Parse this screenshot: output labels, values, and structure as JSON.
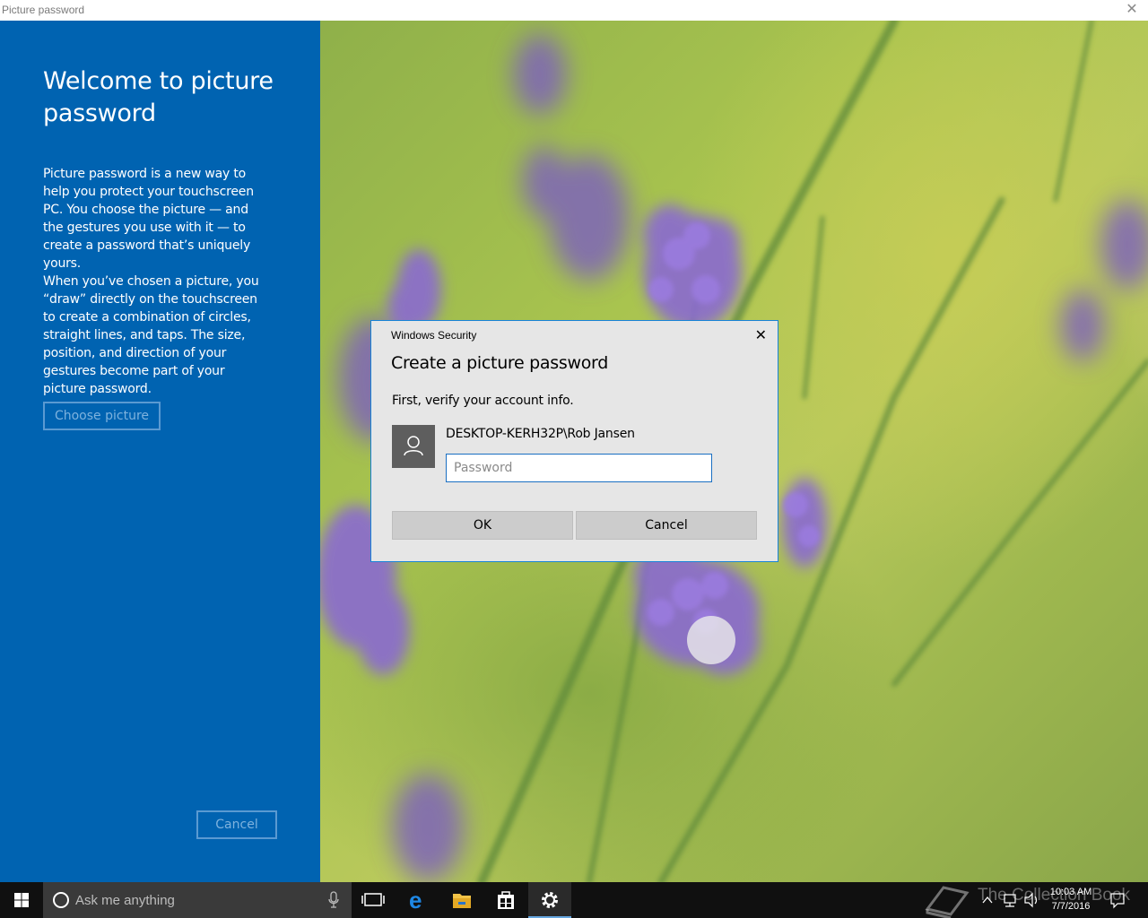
{
  "window": {
    "title": "Picture password"
  },
  "left_panel": {
    "heading": "Welcome to picture password",
    "paragraph1": "Picture password is a new way to help you protect your touchscreen PC. You choose the picture — and the gestures you use with it — to create a password that’s uniquely yours.",
    "paragraph2": "When you’ve chosen a picture, you “draw” directly on the touchscreen to create a combination of circles, straight lines, and taps. The size, position, and direction of your gestures become part of your picture password.",
    "choose_picture_label": "Choose picture",
    "cancel_label": "Cancel"
  },
  "dialog": {
    "title": "Windows Security",
    "heading": "Create a picture password",
    "subtitle": "First, verify your account info.",
    "account_name": "DESKTOP-KERH32P\\Rob Jansen",
    "password_placeholder": "Password",
    "password_value": "",
    "ok_label": "OK",
    "cancel_label": "Cancel"
  },
  "taskbar": {
    "search_placeholder": "Ask me anything",
    "time": "10:03 AM",
    "date": "7/7/2016",
    "watermark": "The Collection Book",
    "pinned": [
      "task-view-icon",
      "edge-icon",
      "file-explorer-icon",
      "store-icon",
      "settings-icon"
    ],
    "active_app": "settings-icon"
  },
  "colors": {
    "panel_blue": "#0063b1",
    "dialog_border": "#1883d7",
    "taskbar": "#101010"
  }
}
